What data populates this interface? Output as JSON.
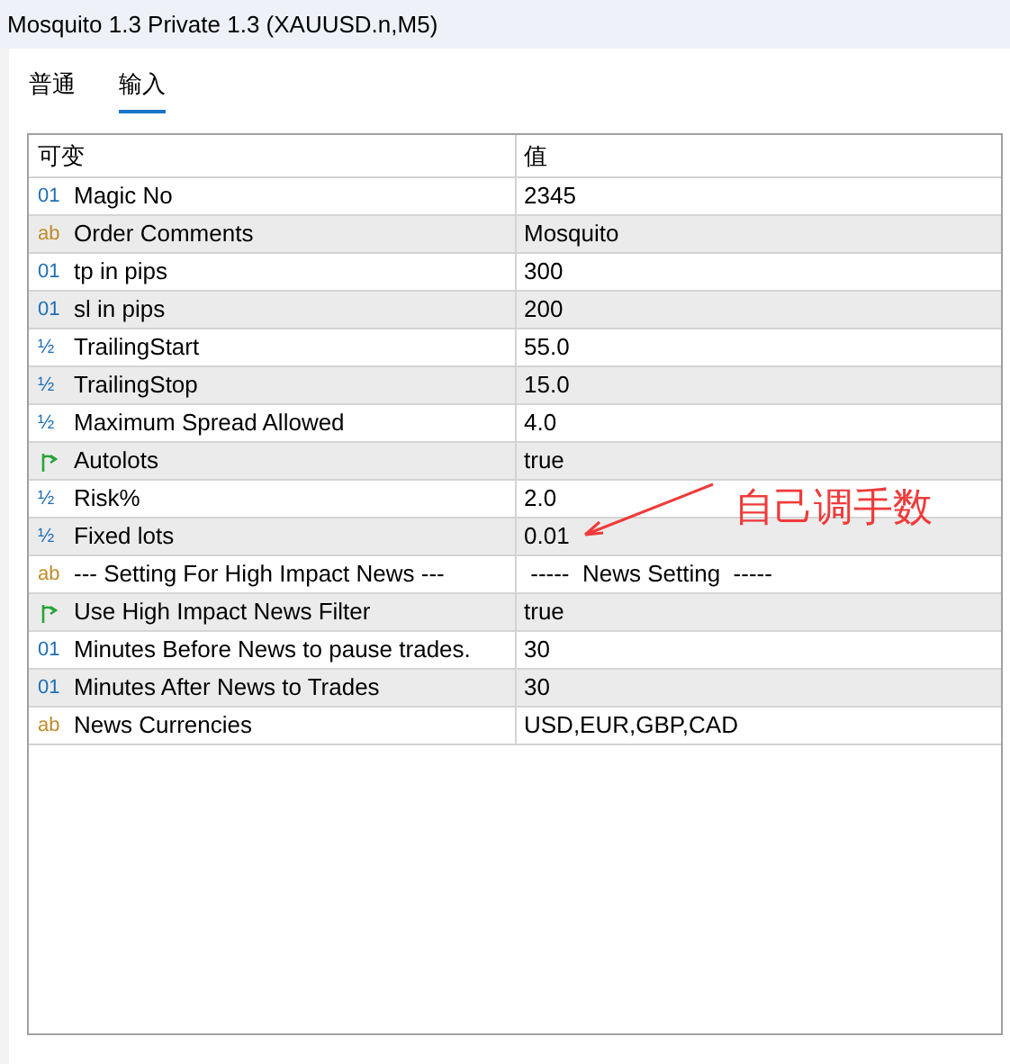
{
  "window": {
    "title": "Mosquito 1.3 Private 1.3 (XAUUSD.n,M5)"
  },
  "tabs": [
    {
      "label": "普通",
      "selected": false
    },
    {
      "label": "输入",
      "selected": true
    }
  ],
  "table": {
    "columns": [
      "可变",
      "值"
    ],
    "rows": [
      {
        "kind": "int",
        "mark": "01",
        "name": "Magic No",
        "value": "2345"
      },
      {
        "kind": "string",
        "mark": "ab",
        "name": "Order Comments",
        "value": "Mosquito"
      },
      {
        "kind": "int",
        "mark": "01",
        "name": "tp in pips",
        "value": "300"
      },
      {
        "kind": "int",
        "mark": "01",
        "name": "sl in pips",
        "value": "200"
      },
      {
        "kind": "double",
        "mark": "½",
        "name": "TrailingStart",
        "value": "55.0"
      },
      {
        "kind": "double",
        "mark": "½",
        "name": "TrailingStop",
        "value": "15.0"
      },
      {
        "kind": "double",
        "mark": "½",
        "name": "Maximum Spread Allowed",
        "value": "4.0"
      },
      {
        "kind": "bool",
        "name": "Autolots",
        "value": "true"
      },
      {
        "kind": "double",
        "mark": "½",
        "name": "Risk%",
        "value": "2.0"
      },
      {
        "kind": "double",
        "mark": "½",
        "name": "Fixed lots",
        "value": "0.01"
      },
      {
        "kind": "string",
        "mark": "ab",
        "name": "--- Setting For High Impact News ---",
        "value": " -----  News Setting  -----"
      },
      {
        "kind": "bool",
        "name": "Use High Impact News Filter",
        "value": "true"
      },
      {
        "kind": "int",
        "mark": "01",
        "name": "Minutes Before News to pause trades.",
        "value": "30"
      },
      {
        "kind": "int",
        "mark": "01",
        "name": "Minutes After News to Trades",
        "value": "30"
      },
      {
        "kind": "string",
        "mark": "ab",
        "name": "News Currencies",
        "value": "USD,EUR,GBP,CAD"
      }
    ]
  },
  "annotation": {
    "text": "自己调手数"
  }
}
